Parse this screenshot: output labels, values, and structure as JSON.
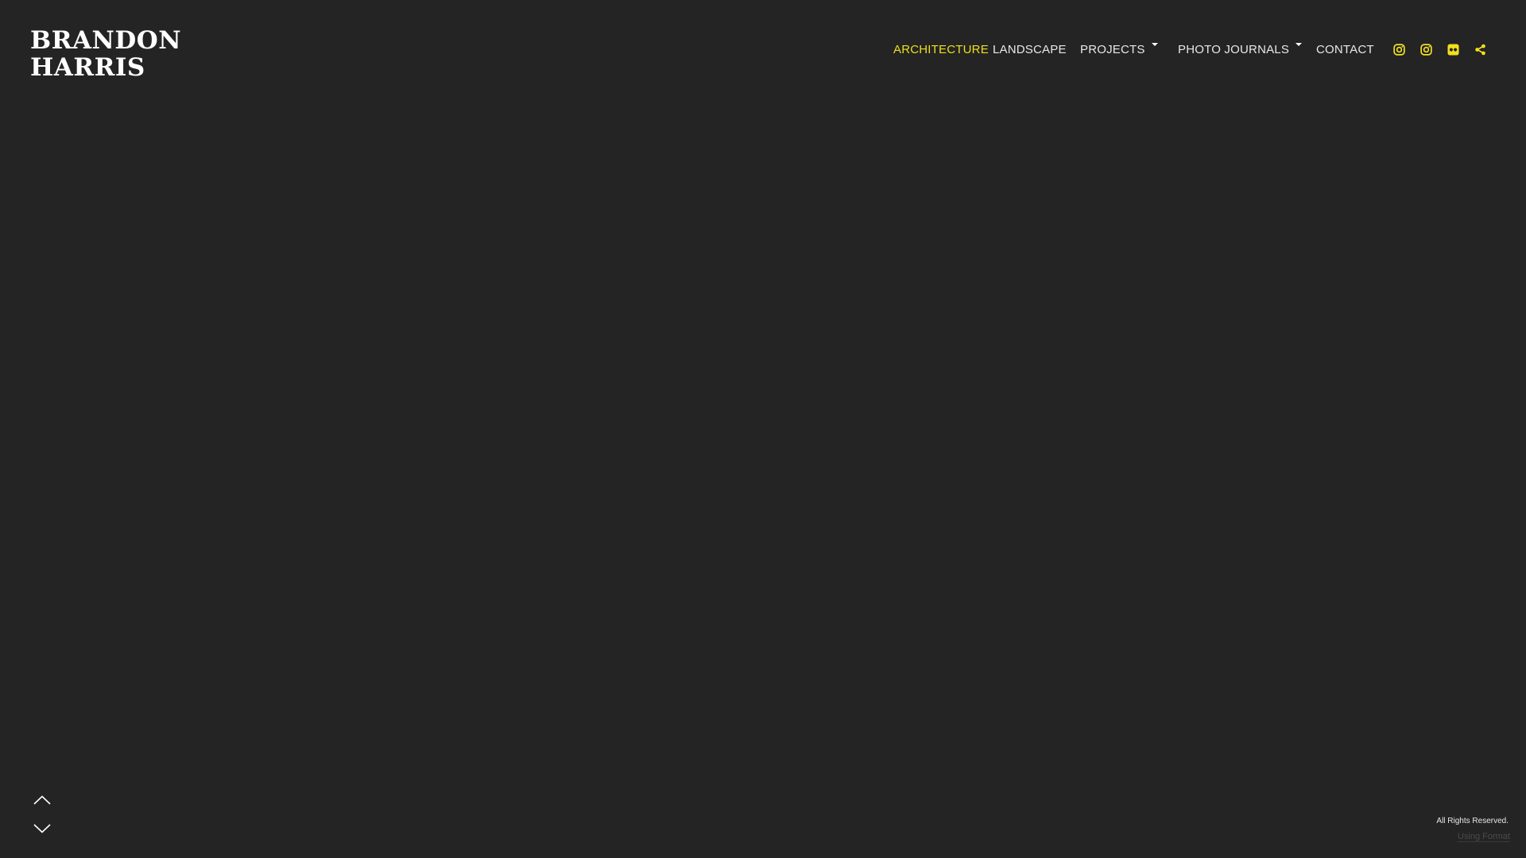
{
  "site": {
    "logo_line1": "BRANDON",
    "logo_line2": "HARRIS"
  },
  "nav": {
    "items": [
      {
        "label": "ARCHITECTURE",
        "active": true
      },
      {
        "label": "LANDSCAPE"
      },
      {
        "label": "PROJECTS",
        "has_dropdown": true
      },
      {
        "label": "PHOTO JOURNALS",
        "has_dropdown": true
      },
      {
        "label": "CONTACT"
      }
    ],
    "social_icons": [
      "instagram-icon",
      "instagram-icon",
      "flickr-icon",
      "share-icon"
    ]
  },
  "colors": {
    "background": "#232423",
    "accent": "#f2df1f",
    "nav_text": "#e8e8e8"
  },
  "footer": {
    "rights": "All Rights Reserved.",
    "credit": "Using Format"
  }
}
